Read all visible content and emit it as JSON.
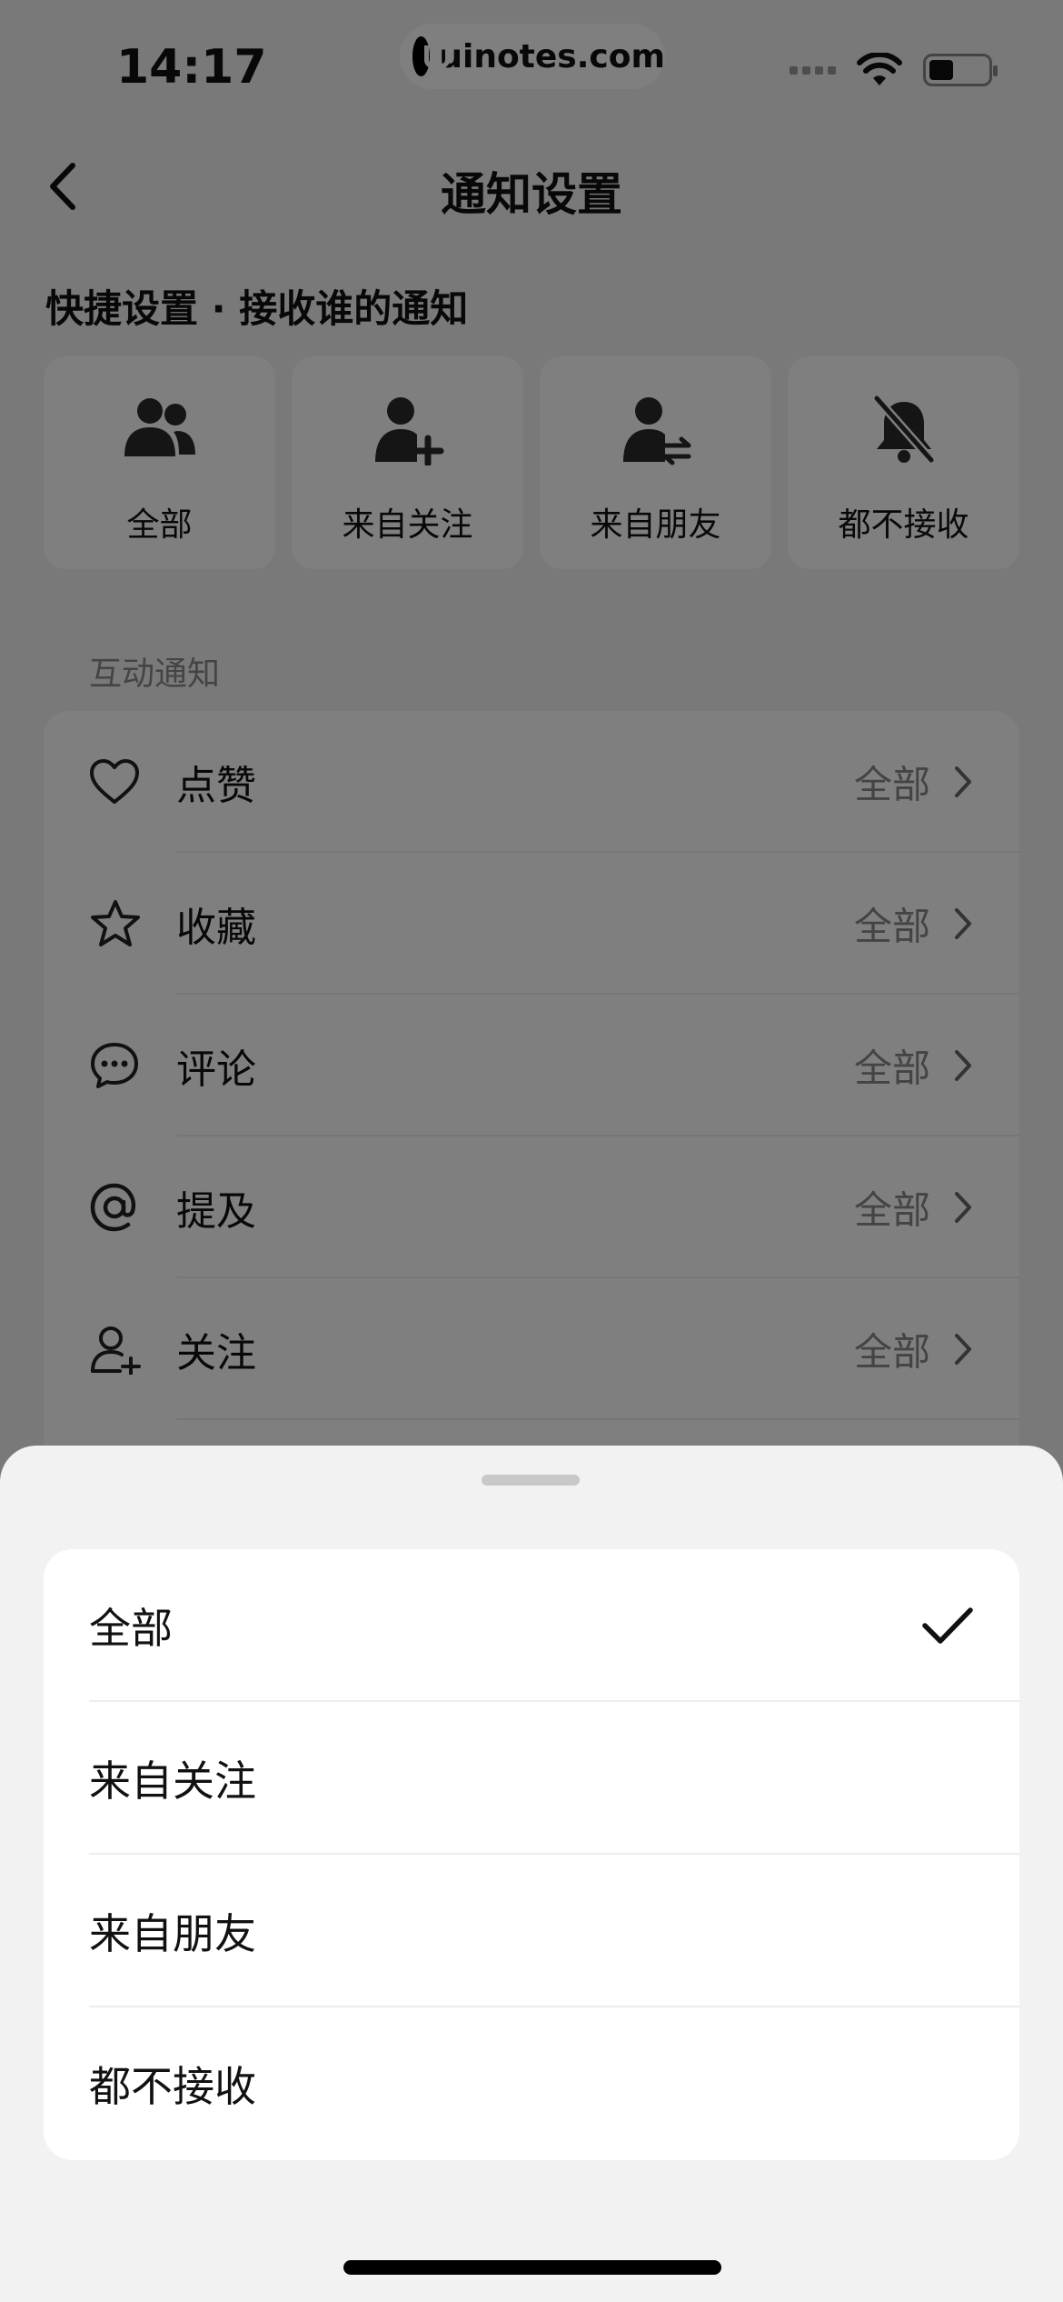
{
  "status_bar": {
    "time": "14:17",
    "watermark": "uinotes.com"
  },
  "nav": {
    "title": "通知设置"
  },
  "quick_settings": {
    "title": "快捷设置 · 接收谁的通知",
    "options": [
      {
        "label": "全部",
        "icon": "people-icon"
      },
      {
        "label": "来自关注",
        "icon": "person-add-icon"
      },
      {
        "label": "来自朋友",
        "icon": "person-swap-icon"
      },
      {
        "label": "都不接收",
        "icon": "bell-off-icon"
      }
    ]
  },
  "interaction": {
    "section_label": "互动通知",
    "items": [
      {
        "label": "点赞",
        "value": "全部",
        "icon": "heart-icon"
      },
      {
        "label": "收藏",
        "value": "全部",
        "icon": "star-icon"
      },
      {
        "label": "评论",
        "value": "全部",
        "icon": "comment-icon"
      },
      {
        "label": "提及",
        "value": "全部",
        "icon": "at-icon"
      },
      {
        "label": "关注",
        "value": "全部",
        "icon": "follow-icon"
      }
    ]
  },
  "sheet": {
    "selected_index": 0,
    "options": [
      {
        "label": "全部"
      },
      {
        "label": "来自关注"
      },
      {
        "label": "来自朋友"
      },
      {
        "label": "都不接收"
      }
    ]
  }
}
